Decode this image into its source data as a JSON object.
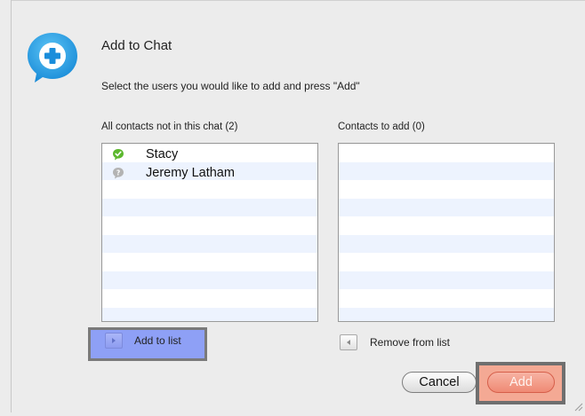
{
  "dialog": {
    "title": "Add to Chat",
    "instruction": "Select the users you would like to add and press \"Add\"",
    "icon": "add-chat-bubble-icon",
    "accent_color": "#1e9be0"
  },
  "available_list": {
    "label": "All contacts not in this chat (2)",
    "contacts": [
      {
        "name": "Stacy",
        "status": "online",
        "status_color": "#5cb82e"
      },
      {
        "name": "Jeremy Latham",
        "status": "offline",
        "status_color": "#b3b3b3"
      }
    ]
  },
  "selected_list": {
    "label": "Contacts to add (0)",
    "contacts": []
  },
  "actions": {
    "add_to_list": "Add to list",
    "remove_from_list": "Remove from list",
    "cancel": "Cancel",
    "add": "Add"
  }
}
